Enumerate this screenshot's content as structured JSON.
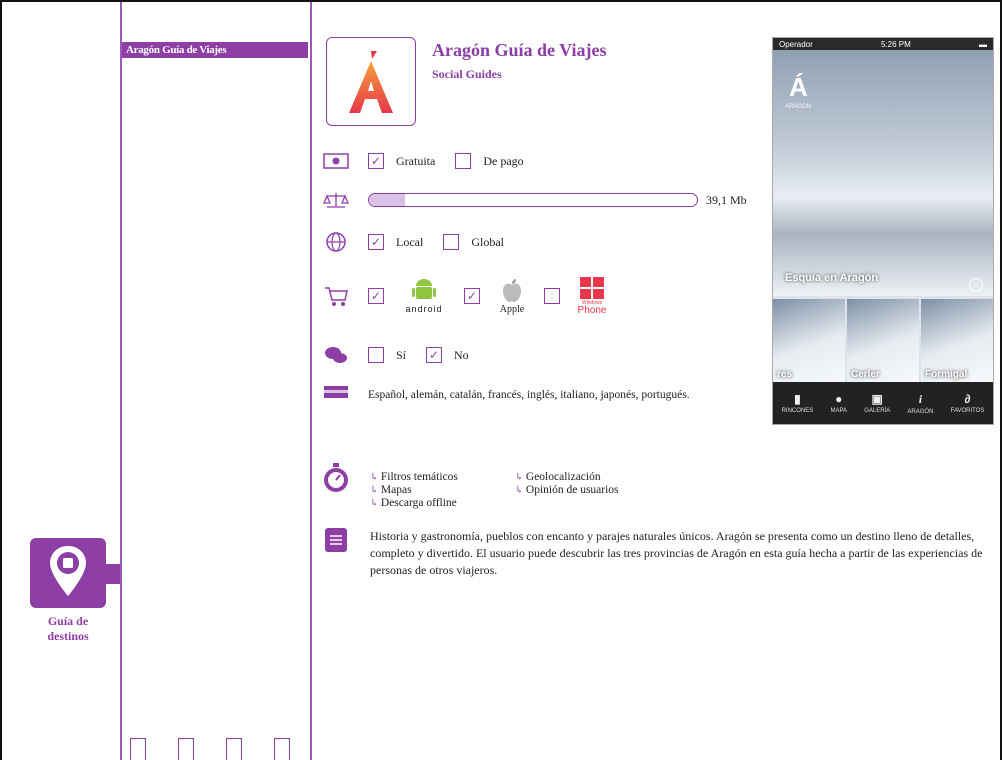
{
  "nav": {
    "tab_label": "Aragón Guía de Viajes"
  },
  "sidebar": {
    "guide_label_line1": "Guía de",
    "guide_label_line2": "destinos"
  },
  "app": {
    "title": "Aragón Guía de Viajes",
    "subtitle": "Social Guides"
  },
  "price": {
    "free_label": "Gratuita",
    "free_checked": true,
    "paid_label": "De pago",
    "paid_checked": false
  },
  "size": {
    "value_label": "39,1 Mb",
    "fill_fraction": 0.11
  },
  "scope": {
    "local_label": "Local",
    "local_checked": true,
    "global_label": "Global",
    "global_checked": false
  },
  "platforms": {
    "android_label": "android",
    "android_checked": true,
    "apple_label": "Apple",
    "apple_checked": true,
    "windows_label_1": "Windows",
    "windows_label_2": "Phone",
    "windows_checked": false
  },
  "social": {
    "yes_label": "Sí",
    "yes_checked": false,
    "no_label": "No",
    "no_checked": true
  },
  "languages": "Español, alemán, catalán, francés, inglés, italiano, japonés, portugués.",
  "features": [
    "Filtros temáticos",
    "Geolocalización",
    "Mapas",
    "Opinión de usuarios",
    "Descarga offline"
  ],
  "description": "Historia y gastronomía, pueblos con encanto y parajes naturales únicos. Aragón se presenta como un destino lleno de detalles, completo y divertido. El usuario puede descubrir las tres provincias de Aragón en esta guía hecha a partir de las experiencias de personas de otros viajeros.",
  "phone": {
    "carrier": "Operador",
    "time": "5:26 PM",
    "brand": "ARAGÓN",
    "hero_caption": "Esquía en Aragón",
    "thumbs": [
      "res",
      "Cerler",
      "Formigal"
    ],
    "tabs": [
      "RINCONES",
      "MAPA",
      "GALERÍA",
      "ARAGÓN",
      "FAVORITOS"
    ]
  },
  "colors": {
    "accent": "#8e3fa6",
    "logo_red": "#e8364a"
  }
}
